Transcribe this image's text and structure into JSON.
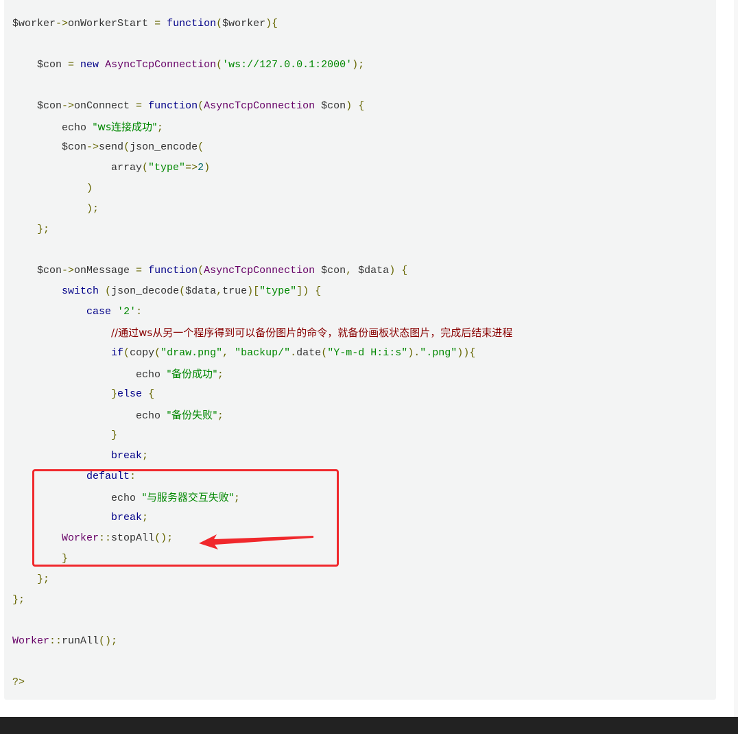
{
  "code_lines": [
    [
      {
        "t": "$worker",
        "c": "plain"
      },
      {
        "t": "->",
        "c": "pun"
      },
      {
        "t": "onWorkerStart ",
        "c": "plain"
      },
      {
        "t": "=",
        "c": "pun"
      },
      {
        "t": " ",
        "c": "plain"
      },
      {
        "t": "function",
        "c": "kw"
      },
      {
        "t": "(",
        "c": "pun"
      },
      {
        "t": "$worker",
        "c": "plain"
      },
      {
        "t": "){",
        "c": "pun"
      }
    ],
    [],
    [
      {
        "t": "    $con ",
        "c": "plain"
      },
      {
        "t": "=",
        "c": "pun"
      },
      {
        "t": " ",
        "c": "plain"
      },
      {
        "t": "new",
        "c": "kw"
      },
      {
        "t": " ",
        "c": "plain"
      },
      {
        "t": "AsyncTcpConnection",
        "c": "cls"
      },
      {
        "t": "(",
        "c": "pun"
      },
      {
        "t": "'ws://127.0.0.1:2000'",
        "c": "str"
      },
      {
        "t": ");",
        "c": "pun"
      }
    ],
    [],
    [
      {
        "t": "    $con",
        "c": "plain"
      },
      {
        "t": "->",
        "c": "pun"
      },
      {
        "t": "onConnect ",
        "c": "plain"
      },
      {
        "t": "=",
        "c": "pun"
      },
      {
        "t": " ",
        "c": "plain"
      },
      {
        "t": "function",
        "c": "kw"
      },
      {
        "t": "(",
        "c": "pun"
      },
      {
        "t": "AsyncTcpConnection",
        "c": "cls"
      },
      {
        "t": " $con",
        "c": "plain"
      },
      {
        "t": ")",
        "c": "pun"
      },
      {
        "t": " ",
        "c": "plain"
      },
      {
        "t": "{",
        "c": "pun"
      }
    ],
    [
      {
        "t": "        echo ",
        "c": "plain"
      },
      {
        "t": "\"ws连接成功\"",
        "c": "str"
      },
      {
        "t": ";",
        "c": "pun"
      }
    ],
    [
      {
        "t": "        $con",
        "c": "plain"
      },
      {
        "t": "->",
        "c": "pun"
      },
      {
        "t": "send",
        "c": "plain"
      },
      {
        "t": "(",
        "c": "pun"
      },
      {
        "t": "json_encode",
        "c": "plain"
      },
      {
        "t": "(",
        "c": "pun"
      }
    ],
    [
      {
        "t": "                array",
        "c": "plain"
      },
      {
        "t": "(",
        "c": "pun"
      },
      {
        "t": "\"type\"",
        "c": "str"
      },
      {
        "t": "=>",
        "c": "pun"
      },
      {
        "t": "2",
        "c": "lit"
      },
      {
        "t": ")",
        "c": "pun"
      }
    ],
    [
      {
        "t": "            ",
        "c": "plain"
      },
      {
        "t": ")",
        "c": "pun"
      }
    ],
    [
      {
        "t": "            ",
        "c": "plain"
      },
      {
        "t": ");",
        "c": "pun"
      }
    ],
    [
      {
        "t": "    ",
        "c": "plain"
      },
      {
        "t": "};",
        "c": "pun"
      }
    ],
    [],
    [
      {
        "t": "    $con",
        "c": "plain"
      },
      {
        "t": "->",
        "c": "pun"
      },
      {
        "t": "onMessage ",
        "c": "plain"
      },
      {
        "t": "=",
        "c": "pun"
      },
      {
        "t": " ",
        "c": "plain"
      },
      {
        "t": "function",
        "c": "kw"
      },
      {
        "t": "(",
        "c": "pun"
      },
      {
        "t": "AsyncTcpConnection",
        "c": "cls"
      },
      {
        "t": " $con",
        "c": "plain"
      },
      {
        "t": ",",
        "c": "pun"
      },
      {
        "t": " $data",
        "c": "plain"
      },
      {
        "t": ")",
        "c": "pun"
      },
      {
        "t": " ",
        "c": "plain"
      },
      {
        "t": "{",
        "c": "pun"
      }
    ],
    [
      {
        "t": "        ",
        "c": "plain"
      },
      {
        "t": "switch",
        "c": "kw"
      },
      {
        "t": " ",
        "c": "plain"
      },
      {
        "t": "(",
        "c": "pun"
      },
      {
        "t": "json_decode",
        "c": "plain"
      },
      {
        "t": "(",
        "c": "pun"
      },
      {
        "t": "$data",
        "c": "plain"
      },
      {
        "t": ",",
        "c": "pun"
      },
      {
        "t": "true",
        "c": "plain"
      },
      {
        "t": ")[",
        "c": "pun"
      },
      {
        "t": "\"type\"",
        "c": "str"
      },
      {
        "t": "])",
        "c": "pun"
      },
      {
        "t": " ",
        "c": "plain"
      },
      {
        "t": "{",
        "c": "pun"
      }
    ],
    [
      {
        "t": "            ",
        "c": "plain"
      },
      {
        "t": "case",
        "c": "kw"
      },
      {
        "t": " ",
        "c": "plain"
      },
      {
        "t": "'2'",
        "c": "str"
      },
      {
        "t": ":",
        "c": "pun"
      }
    ],
    [
      {
        "t": "                ",
        "c": "plain"
      },
      {
        "t": "//通过ws从另一个程序得到可以备份图片的命令，就备份画板状态图片，完成后结束进程",
        "c": "com"
      }
    ],
    [
      {
        "t": "                ",
        "c": "plain"
      },
      {
        "t": "if",
        "c": "kw"
      },
      {
        "t": "(",
        "c": "pun"
      },
      {
        "t": "copy",
        "c": "plain"
      },
      {
        "t": "(",
        "c": "pun"
      },
      {
        "t": "\"draw.png\"",
        "c": "str"
      },
      {
        "t": ",",
        "c": "pun"
      },
      {
        "t": " ",
        "c": "plain"
      },
      {
        "t": "\"backup/\"",
        "c": "str"
      },
      {
        "t": ".",
        "c": "pun"
      },
      {
        "t": "date",
        "c": "plain"
      },
      {
        "t": "(",
        "c": "pun"
      },
      {
        "t": "\"Y-m-d H:i:s\"",
        "c": "str"
      },
      {
        "t": ").",
        "c": "pun"
      },
      {
        "t": "\".png\"",
        "c": "str"
      },
      {
        "t": ")){",
        "c": "pun"
      }
    ],
    [
      {
        "t": "                    echo ",
        "c": "plain"
      },
      {
        "t": "\"备份成功\"",
        "c": "str"
      },
      {
        "t": ";",
        "c": "pun"
      }
    ],
    [
      {
        "t": "                ",
        "c": "plain"
      },
      {
        "t": "}",
        "c": "pun"
      },
      {
        "t": "else",
        "c": "kw"
      },
      {
        "t": " ",
        "c": "plain"
      },
      {
        "t": "{",
        "c": "pun"
      }
    ],
    [
      {
        "t": "                    echo ",
        "c": "plain"
      },
      {
        "t": "\"备份失败\"",
        "c": "str"
      },
      {
        "t": ";",
        "c": "pun"
      }
    ],
    [
      {
        "t": "                ",
        "c": "plain"
      },
      {
        "t": "}",
        "c": "pun"
      }
    ],
    [
      {
        "t": "                ",
        "c": "plain"
      },
      {
        "t": "break",
        "c": "kw"
      },
      {
        "t": ";",
        "c": "pun"
      }
    ],
    [
      {
        "t": "            ",
        "c": "plain"
      },
      {
        "t": "default",
        "c": "kw"
      },
      {
        "t": ":",
        "c": "pun"
      }
    ],
    [
      {
        "t": "                echo ",
        "c": "plain"
      },
      {
        "t": "\"与服务器交互失败\"",
        "c": "str"
      },
      {
        "t": ";",
        "c": "pun"
      }
    ],
    [
      {
        "t": "                ",
        "c": "plain"
      },
      {
        "t": "break",
        "c": "kw"
      },
      {
        "t": ";",
        "c": "pun"
      }
    ],
    [
      {
        "t": "        ",
        "c": "plain"
      },
      {
        "t": "Worker",
        "c": "cls"
      },
      {
        "t": "::",
        "c": "pun"
      },
      {
        "t": "stopAll",
        "c": "plain"
      },
      {
        "t": "();",
        "c": "pun"
      }
    ],
    [
      {
        "t": "        ",
        "c": "plain"
      },
      {
        "t": "}",
        "c": "pun"
      }
    ],
    [
      {
        "t": "    ",
        "c": "plain"
      },
      {
        "t": "};",
        "c": "pun"
      }
    ],
    [
      {
        "t": "};",
        "c": "pun"
      }
    ],
    [],
    [
      {
        "t": "Worker",
        "c": "cls"
      },
      {
        "t": "::",
        "c": "pun"
      },
      {
        "t": "runAll",
        "c": "plain"
      },
      {
        "t": "();",
        "c": "pun"
      }
    ],
    [],
    [
      {
        "t": "?>",
        "c": "pun"
      }
    ]
  ],
  "colors": {
    "code_background": "#f3f4f4",
    "keyword": "#000088",
    "class_name": "#660066",
    "string": "#008800",
    "punctuation": "#666600",
    "literal": "#006666",
    "comment": "#880000",
    "plain": "#333333",
    "annotation_red": "#f0282c",
    "footer": "#222222"
  },
  "annotation": {
    "highlight_box": "red-rectangle",
    "arrow_target_line": "Worker::stopAll();"
  }
}
